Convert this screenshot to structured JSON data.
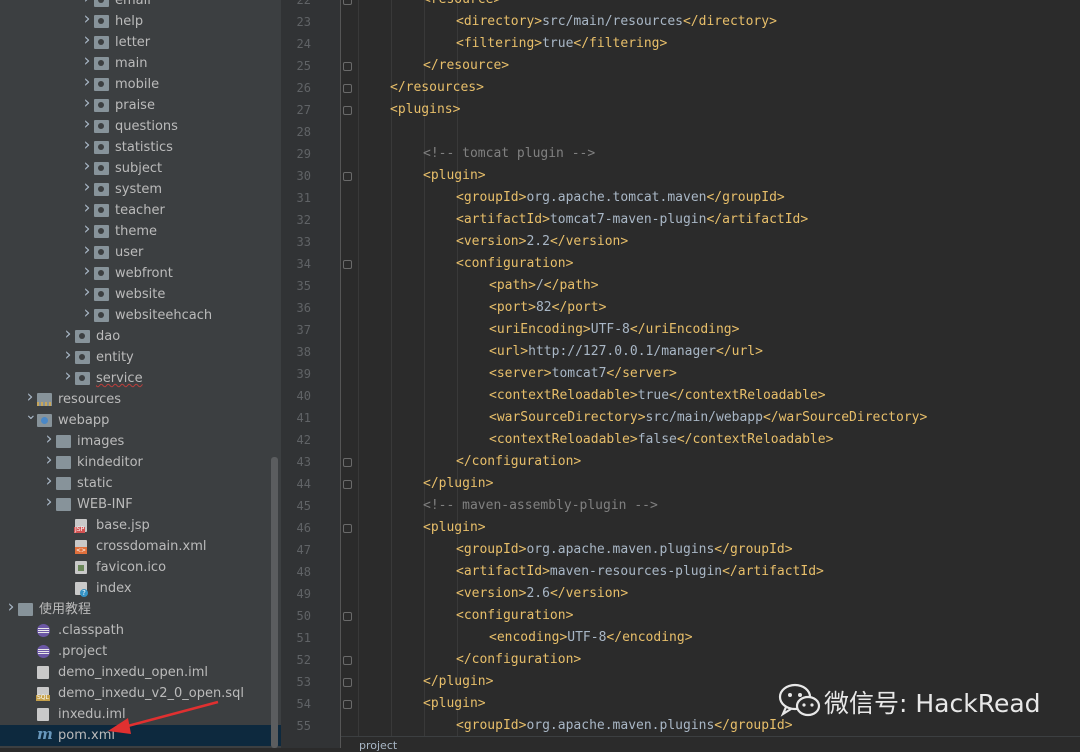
{
  "project_tree": {
    "items": [
      {
        "label": "email",
        "indent": 4,
        "arrow": "right",
        "icon": "package-folder-icon"
      },
      {
        "label": "help",
        "indent": 4,
        "arrow": "right",
        "icon": "package-folder-icon"
      },
      {
        "label": "letter",
        "indent": 4,
        "arrow": "right",
        "icon": "package-folder-icon"
      },
      {
        "label": "main",
        "indent": 4,
        "arrow": "right",
        "icon": "package-folder-icon"
      },
      {
        "label": "mobile",
        "indent": 4,
        "arrow": "right",
        "icon": "package-folder-icon"
      },
      {
        "label": "praise",
        "indent": 4,
        "arrow": "right",
        "icon": "package-folder-icon"
      },
      {
        "label": "questions",
        "indent": 4,
        "arrow": "right",
        "icon": "package-folder-icon"
      },
      {
        "label": "statistics",
        "indent": 4,
        "arrow": "right",
        "icon": "package-folder-icon"
      },
      {
        "label": "subject",
        "indent": 4,
        "arrow": "right",
        "icon": "package-folder-icon"
      },
      {
        "label": "system",
        "indent": 4,
        "arrow": "right",
        "icon": "package-folder-icon"
      },
      {
        "label": "teacher",
        "indent": 4,
        "arrow": "right",
        "icon": "package-folder-icon"
      },
      {
        "label": "theme",
        "indent": 4,
        "arrow": "right",
        "icon": "package-folder-icon"
      },
      {
        "label": "user",
        "indent": 4,
        "arrow": "right",
        "icon": "package-folder-icon"
      },
      {
        "label": "webfront",
        "indent": 4,
        "arrow": "right",
        "icon": "package-folder-icon"
      },
      {
        "label": "website",
        "indent": 4,
        "arrow": "right",
        "icon": "package-folder-icon"
      },
      {
        "label": "websiteehcach",
        "indent": 4,
        "arrow": "right",
        "icon": "package-folder-icon"
      },
      {
        "label": "dao",
        "indent": 3,
        "arrow": "right",
        "icon": "package-folder-icon"
      },
      {
        "label": "entity",
        "indent": 3,
        "arrow": "right",
        "icon": "package-folder-icon"
      },
      {
        "label": "service",
        "indent": 3,
        "arrow": "right",
        "icon": "package-folder-icon",
        "warning": true
      },
      {
        "label": "resources",
        "indent": 1,
        "arrow": "right",
        "icon": "resources-folder-icon"
      },
      {
        "label": "webapp",
        "indent": 1,
        "arrow": "down",
        "icon": "web-folder-icon"
      },
      {
        "label": "images",
        "indent": 2,
        "arrow": "right",
        "icon": "folder-icon"
      },
      {
        "label": "kindeditor",
        "indent": 2,
        "arrow": "right",
        "icon": "folder-icon"
      },
      {
        "label": "static",
        "indent": 2,
        "arrow": "right",
        "icon": "folder-icon"
      },
      {
        "label": "WEB-INF",
        "indent": 2,
        "arrow": "right",
        "icon": "folder-icon"
      },
      {
        "label": "base.jsp",
        "indent": 3,
        "arrow": "none",
        "icon": "jsp-file-icon"
      },
      {
        "label": "crossdomain.xml",
        "indent": 3,
        "arrow": "none",
        "icon": "xml-file-icon"
      },
      {
        "label": "favicon.ico",
        "indent": 3,
        "arrow": "none",
        "icon": "image-file-icon"
      },
      {
        "label": "index",
        "indent": 3,
        "arrow": "none",
        "icon": "unknown-file-icon"
      },
      {
        "label": "使用教程",
        "indent": 0,
        "arrow": "right",
        "icon": "folder-icon"
      },
      {
        "label": ".classpath",
        "indent": 1,
        "arrow": "none",
        "icon": "eclipse-file-icon"
      },
      {
        "label": ".project",
        "indent": 1,
        "arrow": "none",
        "icon": "eclipse-file-icon"
      },
      {
        "label": "demo_inxedu_open.iml",
        "indent": 1,
        "arrow": "none",
        "icon": "iml-file-icon"
      },
      {
        "label": "demo_inxedu_v2_0_open.sql",
        "indent": 1,
        "arrow": "none",
        "icon": "sql-file-icon"
      },
      {
        "label": "inxedu.iml",
        "indent": 1,
        "arrow": "none",
        "icon": "iml-file-icon"
      },
      {
        "label": "pom.xml",
        "indent": 1,
        "arrow": "none",
        "icon": "maven-file-icon",
        "selected": true
      }
    ]
  },
  "editor": {
    "lines": [
      {
        "n": "22",
        "indent": 2,
        "parts": [
          [
            "t",
            "<resource>"
          ]
        ],
        "fold": true
      },
      {
        "n": "23",
        "indent": 3,
        "parts": [
          [
            "t",
            "<directory>"
          ],
          [
            "x",
            "src/main/resources"
          ],
          [
            "t",
            "</directory>"
          ]
        ]
      },
      {
        "n": "24",
        "indent": 3,
        "parts": [
          [
            "t",
            "<filtering>"
          ],
          [
            "x",
            "true"
          ],
          [
            "t",
            "</filtering>"
          ]
        ]
      },
      {
        "n": "25",
        "indent": 2,
        "parts": [
          [
            "t",
            "</resource>"
          ]
        ],
        "fold": true
      },
      {
        "n": "26",
        "indent": 1,
        "parts": [
          [
            "t",
            "</resources>"
          ]
        ],
        "fold": true
      },
      {
        "n": "27",
        "indent": 1,
        "parts": [
          [
            "t",
            "<plugins>"
          ]
        ],
        "fold": true
      },
      {
        "n": "28",
        "indent": 0,
        "parts": []
      },
      {
        "n": "29",
        "indent": 2,
        "parts": [
          [
            "c",
            "<!-- tomcat plugin -->"
          ]
        ]
      },
      {
        "n": "30",
        "indent": 2,
        "parts": [
          [
            "t",
            "<plugin>"
          ]
        ],
        "fold": true
      },
      {
        "n": "31",
        "indent": 3,
        "parts": [
          [
            "t",
            "<groupId>"
          ],
          [
            "x",
            "org.apache.tomcat.maven"
          ],
          [
            "t",
            "</groupId>"
          ]
        ]
      },
      {
        "n": "32",
        "indent": 3,
        "parts": [
          [
            "t",
            "<artifactId>"
          ],
          [
            "x",
            "tomcat7-maven-plugin"
          ],
          [
            "t",
            "</artifactId>"
          ]
        ]
      },
      {
        "n": "33",
        "indent": 3,
        "parts": [
          [
            "t",
            "<version>"
          ],
          [
            "x",
            "2.2"
          ],
          [
            "t",
            "</version>"
          ]
        ]
      },
      {
        "n": "34",
        "indent": 3,
        "parts": [
          [
            "t",
            "<configuration>"
          ]
        ],
        "fold": true
      },
      {
        "n": "35",
        "indent": 4,
        "parts": [
          [
            "t",
            "<path>"
          ],
          [
            "x",
            "/"
          ],
          [
            "t",
            "</path>"
          ]
        ]
      },
      {
        "n": "36",
        "indent": 4,
        "parts": [
          [
            "t",
            "<port>"
          ],
          [
            "x",
            "82"
          ],
          [
            "t",
            "</port>"
          ]
        ]
      },
      {
        "n": "37",
        "indent": 4,
        "parts": [
          [
            "t",
            "<uriEncoding>"
          ],
          [
            "x",
            "UTF-8"
          ],
          [
            "t",
            "</uriEncoding>"
          ]
        ]
      },
      {
        "n": "38",
        "indent": 4,
        "parts": [
          [
            "t",
            "<url>"
          ],
          [
            "x",
            "http://127.0.0.1/manager"
          ],
          [
            "t",
            "</url>"
          ]
        ]
      },
      {
        "n": "39",
        "indent": 4,
        "parts": [
          [
            "t",
            "<server>"
          ],
          [
            "x",
            "tomcat7"
          ],
          [
            "t",
            "</server>"
          ]
        ]
      },
      {
        "n": "40",
        "indent": 4,
        "parts": [
          [
            "t",
            "<contextReloadable>"
          ],
          [
            "x",
            "true"
          ],
          [
            "t",
            "</contextReloadable>"
          ]
        ]
      },
      {
        "n": "41",
        "indent": 4,
        "parts": [
          [
            "t",
            "<warSourceDirectory>"
          ],
          [
            "x",
            "src/main/webapp"
          ],
          [
            "t",
            "</warSourceDirectory>"
          ]
        ]
      },
      {
        "n": "42",
        "indent": 4,
        "parts": [
          [
            "t",
            "<contextReloadable>"
          ],
          [
            "x",
            "false"
          ],
          [
            "t",
            "</contextReloadable>"
          ]
        ]
      },
      {
        "n": "43",
        "indent": 3,
        "parts": [
          [
            "t",
            "</configuration>"
          ]
        ],
        "fold": true
      },
      {
        "n": "44",
        "indent": 2,
        "parts": [
          [
            "t",
            "</plugin>"
          ]
        ],
        "fold": true
      },
      {
        "n": "45",
        "indent": 2,
        "parts": [
          [
            "c",
            "<!-- maven-assembly-plugin -->"
          ]
        ]
      },
      {
        "n": "46",
        "indent": 2,
        "parts": [
          [
            "t",
            "<plugin>"
          ]
        ],
        "fold": true
      },
      {
        "n": "47",
        "indent": 3,
        "parts": [
          [
            "t",
            "<groupId>"
          ],
          [
            "x",
            "org.apache.maven.plugins"
          ],
          [
            "t",
            "</groupId>"
          ]
        ]
      },
      {
        "n": "48",
        "indent": 3,
        "parts": [
          [
            "t",
            "<artifactId>"
          ],
          [
            "x",
            "maven-resources-plugin"
          ],
          [
            "t",
            "</artifactId>"
          ]
        ]
      },
      {
        "n": "49",
        "indent": 3,
        "parts": [
          [
            "t",
            "<version>"
          ],
          [
            "x",
            "2.6"
          ],
          [
            "t",
            "</version>"
          ]
        ]
      },
      {
        "n": "50",
        "indent": 3,
        "parts": [
          [
            "t",
            "<configuration>"
          ]
        ],
        "fold": true
      },
      {
        "n": "51",
        "indent": 4,
        "parts": [
          [
            "t",
            "<encoding>"
          ],
          [
            "x",
            "UTF-8"
          ],
          [
            "t",
            "</encoding>"
          ]
        ]
      },
      {
        "n": "52",
        "indent": 3,
        "parts": [
          [
            "t",
            "</configuration>"
          ]
        ],
        "fold": true
      },
      {
        "n": "53",
        "indent": 2,
        "parts": [
          [
            "t",
            "</plugin>"
          ]
        ],
        "fold": true
      },
      {
        "n": "54",
        "indent": 2,
        "parts": [
          [
            "t",
            "<plugin>"
          ]
        ],
        "fold": true
      },
      {
        "n": "55",
        "indent": 3,
        "parts": [
          [
            "t",
            "<groupId>"
          ],
          [
            "x",
            "org.apache.maven.plugins"
          ],
          [
            "t",
            "</groupId>"
          ]
        ]
      }
    ],
    "bottom_tab": "project"
  },
  "watermark": {
    "text": "微信号: HackRead",
    "icon": "wechat-icon"
  },
  "colors": {
    "tree_bg": "#3c3f41",
    "editor_bg": "#2b2b2b",
    "tag": "#e8bf6a",
    "text": "#a9b7c6",
    "comment": "#808080",
    "line_number": "#606366",
    "selection": "#0d293e",
    "arrow": "#e03030"
  }
}
